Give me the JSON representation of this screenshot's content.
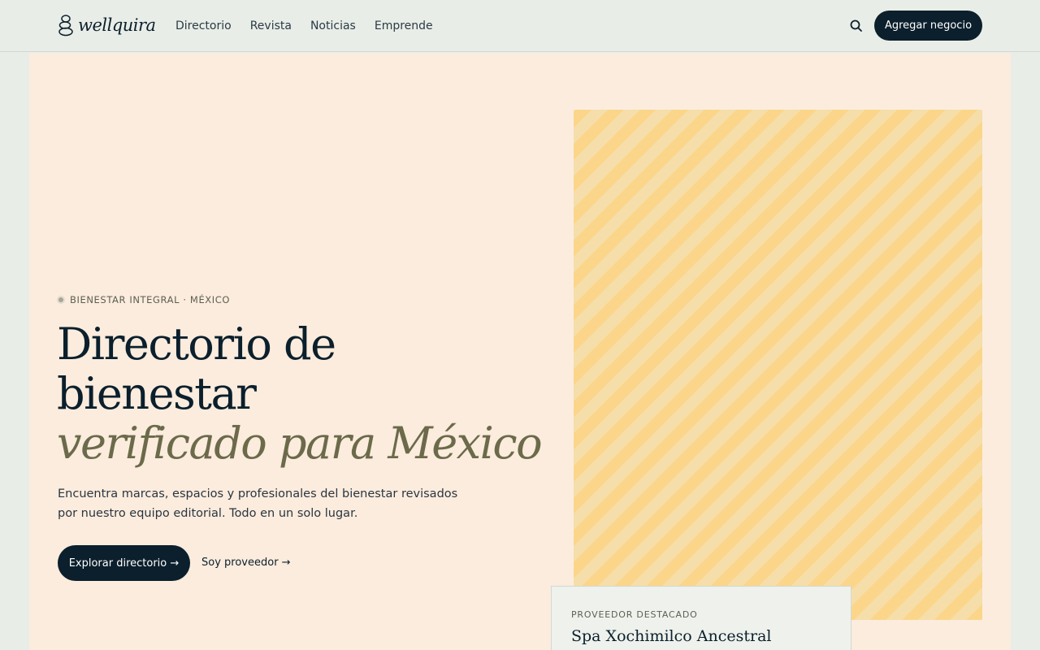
{
  "brand": {
    "name": "wellquira"
  },
  "nav": {
    "items": [
      {
        "label": "Directorio"
      },
      {
        "label": "Revista"
      },
      {
        "label": "Noticias"
      },
      {
        "label": "Emprende"
      }
    ]
  },
  "header": {
    "search_icon": "search-icon",
    "cta_label": "Agregar negocio"
  },
  "hero": {
    "eyebrow": "BIENESTAR INTEGRAL · MÉXICO",
    "headline_line1": "Directorio de",
    "headline_line2": "bienestar",
    "headline_accent": "verificado para México",
    "subtext": "Encuentra marcas, espacios y profesionales del bienestar revisados por nuestro equipo editorial. Todo en un solo lugar.",
    "primary_button": "Explorar directorio →",
    "secondary_link": "Soy proveedor →"
  },
  "featured": {
    "label": "PROVEEDOR DESTACADO",
    "name": "Spa Xochimilco Ancestral"
  },
  "colors": {
    "background": "#e9ede7",
    "hero_background": "#fbecdd",
    "primary": "#0b1f2c",
    "accent": "#6b6a4a",
    "image_stripe_a": "#fbd68a",
    "image_stripe_b": "#f6deaa"
  }
}
